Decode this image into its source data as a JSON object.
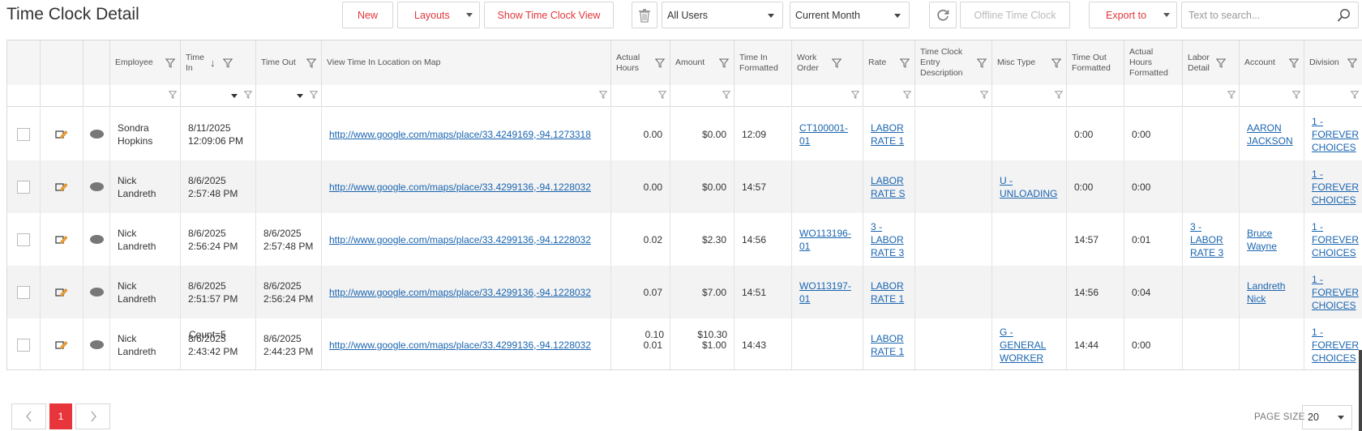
{
  "page": {
    "title": "Time Clock Detail"
  },
  "toolbar": {
    "new_label": "New",
    "layouts_label": "Layouts",
    "show_view_label": "Show Time Clock View",
    "users_value": "All Users",
    "period_value": "Current Month",
    "offline_label": "Offline Time Clock",
    "export_label": "Export to",
    "search_placeholder": "Text to search..."
  },
  "columns": [
    "",
    "",
    "",
    "Employee",
    "Time In",
    "Time Out",
    "View Time In Location on Map",
    "Actual Hours",
    "Amount",
    "Time In Formatted",
    "Work Order",
    "Rate",
    "Time Clock Entry Description",
    "Misc Type",
    "Time Out Formatted",
    "Actual Hours Formatted",
    "Labor Detail",
    "Account",
    "Division"
  ],
  "rows": [
    {
      "employee": "Sondra Hopkins",
      "time_in": "8/11/2025 12:09:06 PM",
      "time_out": "",
      "map": "http://www.google.com/maps/place/33.4249169,-94.1273318",
      "actual_hours": "0.00",
      "amount": "$0.00",
      "time_in_fmt": "12:09",
      "work_order": "CT100001-01",
      "rate": "LABOR RATE 1",
      "desc": "",
      "misc": "",
      "time_out_fmt": "0:00",
      "hours_fmt": "0:00",
      "labor": "",
      "account": "AARON JACKSON",
      "division": "1 - FOREVER CHOICES"
    },
    {
      "employee": "Nick Landreth",
      "time_in": "8/6/2025 2:57:48 PM",
      "time_out": "",
      "map": "http://www.google.com/maps/place/33.4299136,-94.1228032",
      "actual_hours": "0.00",
      "amount": "$0.00",
      "time_in_fmt": "14:57",
      "work_order": "",
      "rate": "LABOR RATE S",
      "desc": "",
      "misc": "U - UNLOADING",
      "time_out_fmt": "0:00",
      "hours_fmt": "0:00",
      "labor": "",
      "account": "",
      "division": "1 - FOREVER CHOICES"
    },
    {
      "employee": "Nick Landreth",
      "time_in": "8/6/2025 2:56:24 PM",
      "time_out": "8/6/2025 2:57:48 PM",
      "map": "http://www.google.com/maps/place/33.4299136,-94.1228032",
      "actual_hours": "0.02",
      "amount": "$2.30",
      "time_in_fmt": "14:56",
      "work_order": "WO113196-01",
      "rate": "3 - LABOR RATE 3",
      "desc": "",
      "misc": "",
      "time_out_fmt": "14:57",
      "hours_fmt": "0:01",
      "labor": "3 - LABOR RATE 3",
      "account": "Bruce Wayne",
      "division": "1 - FOREVER CHOICES"
    },
    {
      "employee": "Nick Landreth",
      "time_in": "8/6/2025 2:51:57 PM",
      "time_out": "8/6/2025 2:56:24 PM",
      "map": "http://www.google.com/maps/place/33.4299136,-94.1228032",
      "actual_hours": "0.07",
      "amount": "$7.00",
      "time_in_fmt": "14:51",
      "work_order": "WO113197-01",
      "rate": "LABOR RATE 1",
      "desc": "",
      "misc": "",
      "time_out_fmt": "14:56",
      "hours_fmt": "0:04",
      "labor": "",
      "account": "Landreth Nick",
      "division": "1 - FOREVER CHOICES"
    },
    {
      "employee": "Nick Landreth",
      "time_in": "8/6/2025 2:43:42 PM",
      "time_out": "8/6/2025 2:44:23 PM",
      "map": "http://www.google.com/maps/place/33.4299136,-94.1228032",
      "actual_hours": "0.01",
      "amount": "$1.00",
      "time_in_fmt": "14:43",
      "work_order": "",
      "rate": "LABOR RATE 1",
      "desc": "",
      "misc": "G - GENERAL WORKER",
      "time_out_fmt": "14:44",
      "hours_fmt": "0:00",
      "labor": "",
      "account": "",
      "division": "1 - FOREVER CHOICES"
    }
  ],
  "footer": {
    "count": "Count=5",
    "hours_total": "0.10",
    "amount_total": "$10.30"
  },
  "pagination": {
    "current_page": "1",
    "page_size_label": "PAGE SIZE",
    "page_size": "20"
  },
  "colors": {
    "accent": "#e8353b",
    "link": "#1a65b0",
    "header_bg": "#f5f5f5",
    "alt_row": "#f3f3f3"
  }
}
